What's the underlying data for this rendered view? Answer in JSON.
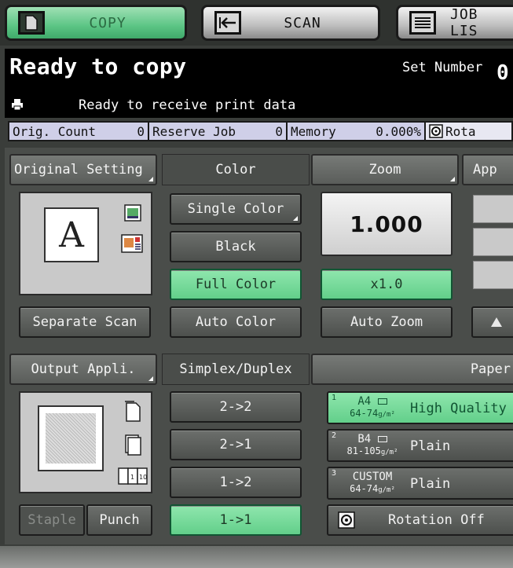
{
  "tabs": [
    {
      "label": "COPY",
      "active": true,
      "icon": "copy-doc-icon"
    },
    {
      "label": "SCAN",
      "active": false,
      "icon": "scan-arrow-icon"
    },
    {
      "label": "JOB LIS",
      "active": false,
      "icon": "job-list-icon"
    }
  ],
  "status": {
    "title": "Ready to copy",
    "set_number_label": "Set Number",
    "set_number_value": "0",
    "message": "Ready to receive print data"
  },
  "info": {
    "orig_count_label": "Orig. Count",
    "orig_count_value": "0",
    "reserve_job_label": "Reserve Job",
    "reserve_job_value": "0",
    "memory_label": "Memory",
    "memory_value": "0.000%",
    "rota_label": "Rota"
  },
  "original_setting": {
    "header": "Original Setting",
    "preview_letter": "A",
    "separate_scan": "Separate Scan"
  },
  "color": {
    "header": "Color",
    "single_color": "Single Color",
    "black": "Black",
    "full_color": "Full Color",
    "auto_color": "Auto Color",
    "selected": "Full Color"
  },
  "zoom": {
    "header": "Zoom",
    "value": "1.000",
    "x10": "x1.0",
    "auto_zoom": "Auto Zoom"
  },
  "app": {
    "header": "App"
  },
  "output": {
    "header": "Output Appli.",
    "staple": "Staple",
    "punch": "Punch"
  },
  "duplex": {
    "header": "Simplex/Duplex",
    "options": [
      "2->2",
      "2->1",
      "1->2",
      "1->1"
    ],
    "selected": "1->1"
  },
  "paper": {
    "header": "Paper",
    "trays": [
      {
        "num": "1",
        "size": "A4",
        "weight": "64-74",
        "weight_unit": "g/m²",
        "type": "High Quality",
        "selected": true
      },
      {
        "num": "2",
        "size": "B4",
        "weight": "81-105",
        "weight_unit": "g/m²",
        "type": "Plain",
        "selected": false
      },
      {
        "num": "3",
        "size": "CUSTOM",
        "weight": "64-74",
        "weight_unit": "g/m²",
        "type": "Plain",
        "selected": false
      }
    ],
    "rotation": "Rotation Off"
  },
  "colors": {
    "active_green": "#62cf8a",
    "panel_gray": "#4a4d4a",
    "status_bg": "#000000"
  }
}
